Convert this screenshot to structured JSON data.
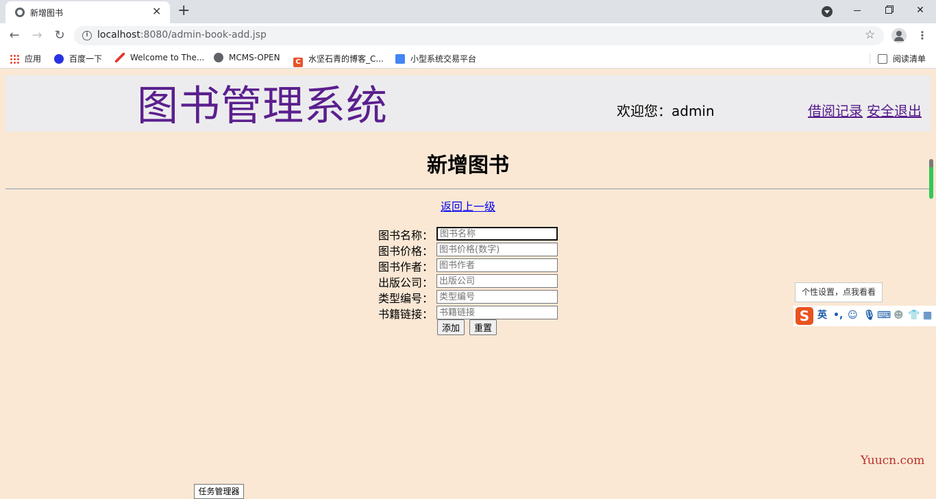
{
  "browser": {
    "tab_title": "新增图书",
    "tab_close": "✕",
    "new_tab": "+",
    "url_host": "localhost",
    "url_path": ":8080/admin-book-add.jsp",
    "window_buttons": {
      "minimize": "minimize",
      "maximize": "maximize",
      "close": "✕"
    },
    "nav": {
      "back": "←",
      "forward": "→",
      "reload": "↻"
    },
    "bookmarks": [
      {
        "label": "应用",
        "icon": "apps-grid-icon"
      },
      {
        "label": "百度一下",
        "icon": "baidu-paw-icon"
      },
      {
        "label": "Welcome to The...",
        "icon": "pen-icon"
      },
      {
        "label": "MCMS-OPEN",
        "icon": "globe-icon"
      },
      {
        "label": "水坚石青的博客_C...",
        "icon": "csdn-c-icon"
      },
      {
        "label": "小型系统交易平台",
        "icon": "document-icon"
      }
    ],
    "reading_list": "阅读清单"
  },
  "header": {
    "system_title": "图书管理系统",
    "welcome": "欢迎您：admin",
    "borrow_link": "借阅记录",
    "logout_link": "安全退出"
  },
  "main": {
    "heading": "新增图书",
    "back_link": "返回上一级",
    "fields": [
      {
        "label": "图书名称：",
        "placeholder": "图书名称",
        "value": ""
      },
      {
        "label": "图书价格：",
        "placeholder": "图书价格(数字)",
        "value": ""
      },
      {
        "label": "图书作者：",
        "placeholder": "图书作者",
        "value": ""
      },
      {
        "label": "出版公司：",
        "placeholder": "出版公司",
        "value": ""
      },
      {
        "label": "类型编号：",
        "placeholder": "类型编号",
        "value": ""
      },
      {
        "label": "书籍链接：",
        "placeholder": "书籍链接",
        "value": ""
      }
    ],
    "add_button": "添加",
    "reset_button": "重置"
  },
  "ime": {
    "tooltip": "个性设置，点我看看",
    "logo": "S",
    "mode": "英",
    "punct": "•,"
  },
  "watermark": "Yuucn.com",
  "taskbar_tooltip": "任务管理器"
}
